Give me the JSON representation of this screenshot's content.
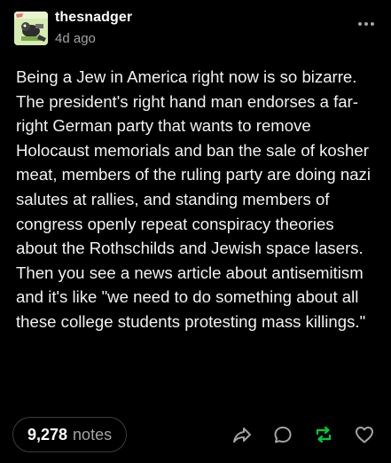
{
  "post": {
    "author": "thesnadger",
    "timestamp": "4d ago",
    "body": "Being a Jew in America right now is so bizarre. The president's right hand man endorses a far-right German party that wants to remove Holocaust memorials and ban the sale of kosher meat, members of the ruling party are doing nazi salutes at rallies, and standing members of congress openly repeat conspiracy theories about the Rothschilds and Jewish space lasers. Then you see a news article about antisemitism and it's like \"we need to do something about all these college students protesting mass killings.\""
  },
  "footer": {
    "notes_count": "9,278",
    "notes_label": "notes"
  },
  "icons": {
    "more": "more-horizontal-icon",
    "share": "share-icon",
    "reply": "reply-icon",
    "reblog": "reblog-icon",
    "like": "heart-icon"
  },
  "colors": {
    "background": "#000000",
    "text": "#f2f2f2",
    "muted": "#a3a3a3",
    "reblog_accent": "#00cf35",
    "pill_border": "#3c3c3c"
  }
}
